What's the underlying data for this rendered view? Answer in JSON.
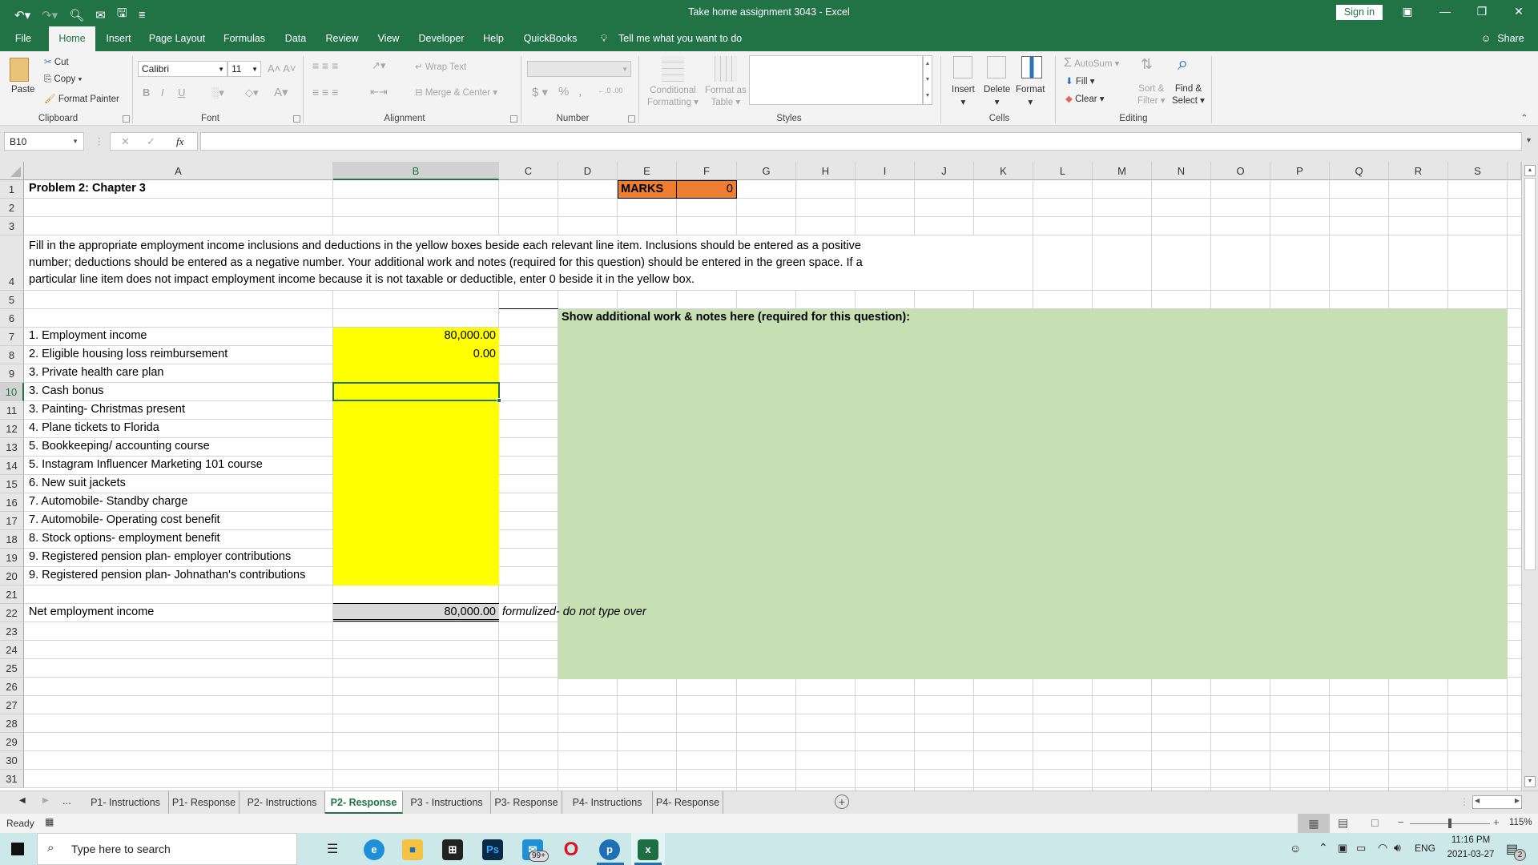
{
  "window": {
    "title": "Take home assignment 3043  -  Excel",
    "sign_in": "Sign in",
    "share": "Share"
  },
  "ribbon_tabs": [
    "File",
    "Home",
    "Insert",
    "Page Layout",
    "Formulas",
    "Data",
    "Review",
    "View",
    "Developer",
    "Help",
    "QuickBooks"
  ],
  "active_tab": "Home",
  "tell_me": "Tell me what you want to do",
  "ribbon": {
    "clipboard": {
      "label": "Clipboard",
      "paste": "Paste",
      "cut": "Cut",
      "copy": "Copy",
      "format_painter": "Format Painter"
    },
    "font": {
      "label": "Font",
      "font_name": "Calibri",
      "font_size": "11",
      "bold": "B",
      "italic": "I",
      "underline": "U"
    },
    "alignment": {
      "label": "Alignment",
      "wrap_text": "Wrap Text",
      "merge_center": "Merge & Center"
    },
    "number": {
      "label": "Number",
      "format_value": "",
      "currency": "$",
      "percent": "%",
      "comma": ","
    },
    "styles": {
      "label": "Styles",
      "conditional": "Conditional",
      "conditional2": "Formatting",
      "format_as": "Format as",
      "format_as2": "Table"
    },
    "cells": {
      "label": "Cells",
      "insert": "Insert",
      "delete": "Delete",
      "format": "Format"
    },
    "editing": {
      "label": "Editing",
      "autosum": "AutoSum",
      "fill": "Fill",
      "clear": "Clear",
      "sort": "Sort &",
      "sort2": "Filter",
      "find": "Find &",
      "find2": "Select"
    }
  },
  "formula_bar": {
    "name_box": "B10",
    "fx": "fx",
    "formula": ""
  },
  "columns": [
    "A",
    "B",
    "C",
    "D",
    "E",
    "F",
    "G",
    "H",
    "I",
    "J",
    "K",
    "L",
    "M",
    "N",
    "O",
    "P",
    "Q",
    "R",
    "S"
  ],
  "selected_column": "B",
  "selected_row": 10,
  "rows": [
    1,
    2,
    3,
    4,
    5,
    6,
    7,
    8,
    9,
    10,
    11,
    12,
    13,
    14,
    15,
    16,
    17,
    18,
    19,
    20,
    21,
    22,
    23,
    24,
    25,
    26,
    27,
    28,
    29,
    30,
    31
  ],
  "sheet": {
    "title": "Problem 2: Chapter 3",
    "marks_label": "MARKS",
    "marks_value": "0",
    "instructions_lines": [
      "Fill in the appropriate employment income inclusions and deductions in the yellow boxes beside each relevant line item. Inclusions should be entered as a positive",
      "number; deductions should be entered as a negative number. Your additional work and notes (required for this question) should be entered in the green space. If a",
      "particular line item does not impact employment income because it is not taxable or deductible, enter 0 beside it in the yellow box."
    ],
    "notes_heading": "Show additional work & notes here (required for this question):",
    "line_items": [
      {
        "row": 7,
        "label": "1. Employment income",
        "value": "80,000.00"
      },
      {
        "row": 8,
        "label": "2. Eligible housing loss reimbursement",
        "value": "0.00"
      },
      {
        "row": 9,
        "label": "3. Private health care plan",
        "value": ""
      },
      {
        "row": 10,
        "label": "3. Cash bonus",
        "value": ""
      },
      {
        "row": 11,
        "label": "3. Painting- Christmas present",
        "value": ""
      },
      {
        "row": 12,
        "label": "4. Plane tickets to Florida",
        "value": ""
      },
      {
        "row": 13,
        "label": "5. Bookkeeping/ accounting course",
        "value": ""
      },
      {
        "row": 14,
        "label": "5. Instagram Influencer Marketing 101 course",
        "value": ""
      },
      {
        "row": 15,
        "label": "6. New suit jackets",
        "value": ""
      },
      {
        "row": 16,
        "label": "7. Automobile- Standby charge",
        "value": ""
      },
      {
        "row": 17,
        "label": "7. Automobile- Operating cost benefit",
        "value": ""
      },
      {
        "row": 18,
        "label": "8. Stock options- employment benefit",
        "value": ""
      },
      {
        "row": 19,
        "label": "9. Registered pension plan- employer contributions",
        "value": ""
      },
      {
        "row": 20,
        "label": "9. Registered pension plan- Johnathan's contributions",
        "value": ""
      }
    ],
    "net_label": "Net employment income",
    "net_value": "80,000.00",
    "net_note": "formulized- do not type over",
    "colors": {
      "yellow": "#ffff00",
      "green": "#c6e0b4",
      "orange": "#ed7d31",
      "total_gray": "#d9d9d9",
      "excel_green": "#217346"
    }
  },
  "sheet_tabs": [
    "P1- Instructions",
    "P1- Response",
    "P2- Instructions",
    "P2- Response",
    "P3 - Instructions",
    "P3- Response",
    "P4- Instructions",
    "P4- Response"
  ],
  "active_sheet": "P2- Response",
  "status": {
    "ready": "Ready",
    "zoom": "115%"
  },
  "taskbar": {
    "search_placeholder": "Type here to search",
    "mail_badge": "99+",
    "language": "ENG",
    "time": "11:16 PM",
    "date": "2021-03-27",
    "notifications": "2"
  }
}
